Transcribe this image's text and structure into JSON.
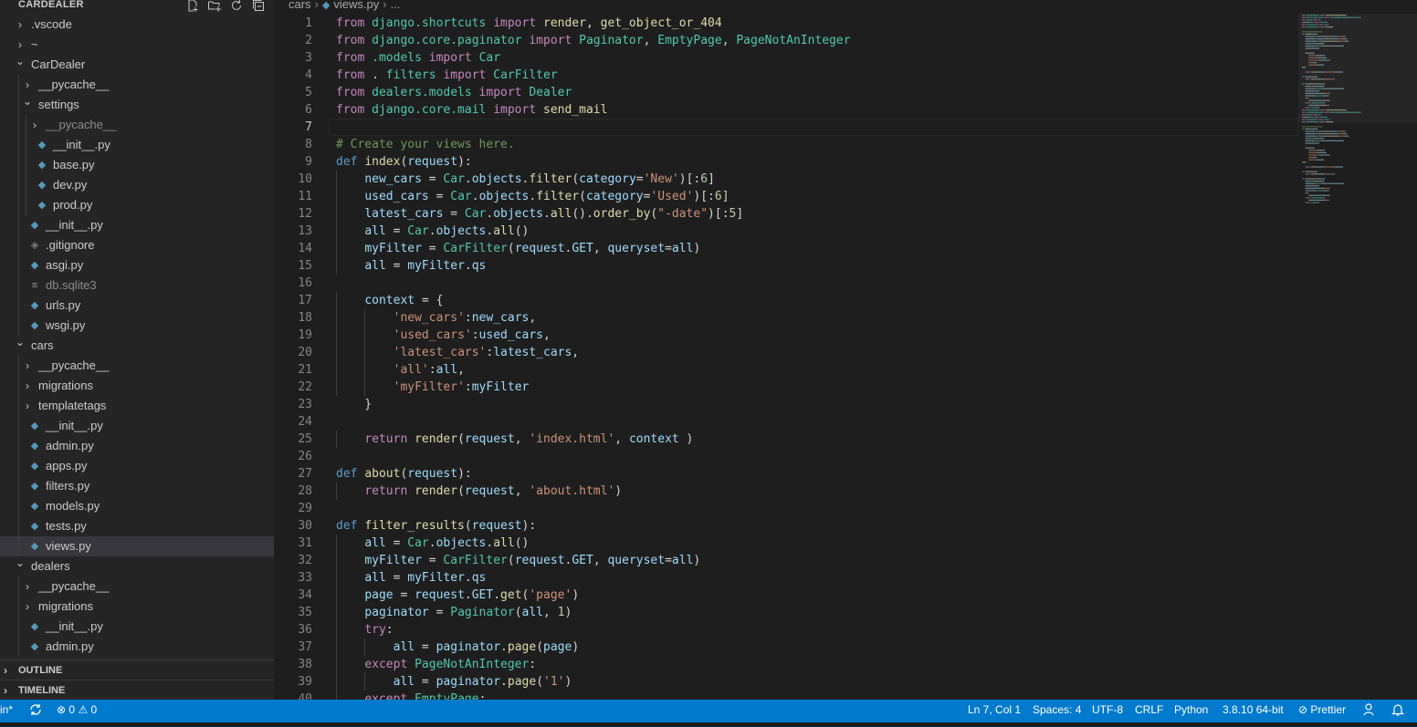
{
  "sidebar": {
    "title": "CARDEALER",
    "actions": [
      {
        "name": "new-file-icon",
        "glyph": "+"
      },
      {
        "name": "new-folder-icon",
        "glyph": "▭"
      },
      {
        "name": "refresh-icon",
        "glyph": "↻"
      },
      {
        "name": "collapse-all-icon",
        "glyph": "⊟"
      }
    ],
    "tree": [
      {
        "label": ".vscode",
        "type": "folder",
        "depth": 0,
        "open": false
      },
      {
        "label": "~",
        "type": "folder",
        "depth": 0,
        "open": false
      },
      {
        "label": "CarDealer",
        "type": "folder",
        "depth": 0,
        "open": true
      },
      {
        "label": "__pycache__",
        "type": "folder",
        "depth": 1,
        "open": false
      },
      {
        "label": "settings",
        "type": "folder",
        "depth": 1,
        "open": true
      },
      {
        "label": "__pycache__",
        "type": "folder",
        "depth": 2,
        "open": false,
        "muted": true
      },
      {
        "label": "__init__.py",
        "type": "py",
        "depth": 2
      },
      {
        "label": "base.py",
        "type": "py",
        "depth": 2
      },
      {
        "label": "dev.py",
        "type": "py",
        "depth": 2
      },
      {
        "label": "prod.py",
        "type": "py",
        "depth": 2
      },
      {
        "label": "__init__.py",
        "type": "py",
        "depth": 1
      },
      {
        "label": ".gitignore",
        "type": "git",
        "depth": 1
      },
      {
        "label": "asgi.py",
        "type": "py",
        "depth": 1
      },
      {
        "label": "db.sqlite3",
        "type": "db",
        "depth": 1,
        "muted": true
      },
      {
        "label": "urls.py",
        "type": "py",
        "depth": 1
      },
      {
        "label": "wsgi.py",
        "type": "py",
        "depth": 1
      },
      {
        "label": "cars",
        "type": "folder",
        "depth": 0,
        "open": true
      },
      {
        "label": "__pycache__",
        "type": "folder",
        "depth": 1,
        "open": false
      },
      {
        "label": "migrations",
        "type": "folder",
        "depth": 1,
        "open": false
      },
      {
        "label": "templatetags",
        "type": "folder",
        "depth": 1,
        "open": false
      },
      {
        "label": "__init__.py",
        "type": "py",
        "depth": 1
      },
      {
        "label": "admin.py",
        "type": "py",
        "depth": 1
      },
      {
        "label": "apps.py",
        "type": "py",
        "depth": 1
      },
      {
        "label": "filters.py",
        "type": "py",
        "depth": 1
      },
      {
        "label": "models.py",
        "type": "py",
        "depth": 1
      },
      {
        "label": "tests.py",
        "type": "py",
        "depth": 1
      },
      {
        "label": "views.py",
        "type": "py",
        "depth": 1,
        "active": true
      },
      {
        "label": "dealers",
        "type": "folder",
        "depth": 0,
        "open": true
      },
      {
        "label": "__pycache__",
        "type": "folder",
        "depth": 1,
        "open": false
      },
      {
        "label": "migrations",
        "type": "folder",
        "depth": 1,
        "open": false
      },
      {
        "label": "__init__.py",
        "type": "py",
        "depth": 1
      },
      {
        "label": "admin.py",
        "type": "py",
        "depth": 1
      }
    ],
    "panels": {
      "outline": "OUTLINE",
      "timeline": "TIMELINE"
    }
  },
  "breadcrumb": {
    "folder": "cars",
    "file": "views.py",
    "more": "..."
  },
  "editor": {
    "current_line": 7,
    "lines": [
      [
        [
          "kw",
          "from"
        ],
        [
          "t",
          " "
        ],
        [
          "mod",
          "django.shortcuts"
        ],
        [
          "t",
          " "
        ],
        [
          "kw",
          "import"
        ],
        [
          "t",
          " "
        ],
        [
          "fn",
          "render"
        ],
        [
          "t",
          ", "
        ],
        [
          "fn",
          "get_object_or_404"
        ]
      ],
      [
        [
          "kw",
          "from"
        ],
        [
          "t",
          " "
        ],
        [
          "mod",
          "django.core.paginator"
        ],
        [
          "t",
          " "
        ],
        [
          "kw",
          "import"
        ],
        [
          "t",
          " "
        ],
        [
          "cls",
          "Paginator"
        ],
        [
          "t",
          ", "
        ],
        [
          "cls",
          "EmptyPage"
        ],
        [
          "t",
          ", "
        ],
        [
          "cls",
          "PageNotAnInteger"
        ]
      ],
      [
        [
          "kw",
          "from"
        ],
        [
          "t",
          " "
        ],
        [
          "mod",
          ".models"
        ],
        [
          "t",
          " "
        ],
        [
          "kw",
          "import"
        ],
        [
          "t",
          " "
        ],
        [
          "cls",
          "Car"
        ]
      ],
      [
        [
          "kw",
          "from"
        ],
        [
          "t",
          " . "
        ],
        [
          "mod",
          "filters"
        ],
        [
          "t",
          " "
        ],
        [
          "kw",
          "import"
        ],
        [
          "t",
          " "
        ],
        [
          "cls",
          "CarFilter"
        ]
      ],
      [
        [
          "kw",
          "from"
        ],
        [
          "t",
          " "
        ],
        [
          "mod",
          "dealers.models"
        ],
        [
          "t",
          " "
        ],
        [
          "kw",
          "import"
        ],
        [
          "t",
          " "
        ],
        [
          "cls",
          "Dealer"
        ]
      ],
      [
        [
          "kw",
          "from"
        ],
        [
          "t",
          " "
        ],
        [
          "mod",
          "django.core.mail"
        ],
        [
          "t",
          " "
        ],
        [
          "kw",
          "import"
        ],
        [
          "t",
          " "
        ],
        [
          "fn",
          "send_mail"
        ]
      ],
      [],
      [
        [
          "cmt",
          "# Create your views here."
        ]
      ],
      [
        [
          "kwb",
          "def"
        ],
        [
          "t",
          " "
        ],
        [
          "fn",
          "index"
        ],
        [
          "t",
          "("
        ],
        [
          "var",
          "request"
        ],
        [
          "t",
          "):"
        ]
      ],
      [
        [
          "t",
          "    "
        ],
        [
          "var",
          "new_cars"
        ],
        [
          "t",
          " = "
        ],
        [
          "cls",
          "Car"
        ],
        [
          "t",
          "."
        ],
        [
          "var",
          "objects"
        ],
        [
          "t",
          "."
        ],
        [
          "fn",
          "filter"
        ],
        [
          "t",
          "("
        ],
        [
          "var",
          "category"
        ],
        [
          "t",
          "="
        ],
        [
          "str",
          "'New'"
        ],
        [
          "t",
          ")[:"
        ],
        [
          "num",
          "6"
        ],
        [
          "t",
          "]"
        ]
      ],
      [
        [
          "t",
          "    "
        ],
        [
          "var",
          "used_cars"
        ],
        [
          "t",
          " = "
        ],
        [
          "cls",
          "Car"
        ],
        [
          "t",
          "."
        ],
        [
          "var",
          "objects"
        ],
        [
          "t",
          "."
        ],
        [
          "fn",
          "filter"
        ],
        [
          "t",
          "("
        ],
        [
          "var",
          "category"
        ],
        [
          "t",
          "="
        ],
        [
          "str",
          "'Used'"
        ],
        [
          "t",
          ")[:"
        ],
        [
          "num",
          "6"
        ],
        [
          "t",
          "]"
        ]
      ],
      [
        [
          "t",
          "    "
        ],
        [
          "var",
          "latest_cars"
        ],
        [
          "t",
          " = "
        ],
        [
          "cls",
          "Car"
        ],
        [
          "t",
          "."
        ],
        [
          "var",
          "objects"
        ],
        [
          "t",
          "."
        ],
        [
          "fn",
          "all"
        ],
        [
          "t",
          "()."
        ],
        [
          "fn",
          "order_by"
        ],
        [
          "t",
          "("
        ],
        [
          "str",
          "\"-date\""
        ],
        [
          "t",
          ")[:"
        ],
        [
          "num",
          "5"
        ],
        [
          "t",
          "]"
        ]
      ],
      [
        [
          "t",
          "    "
        ],
        [
          "var",
          "all"
        ],
        [
          "t",
          " = "
        ],
        [
          "cls",
          "Car"
        ],
        [
          "t",
          "."
        ],
        [
          "var",
          "objects"
        ],
        [
          "t",
          "."
        ],
        [
          "fn",
          "all"
        ],
        [
          "t",
          "()"
        ]
      ],
      [
        [
          "t",
          "    "
        ],
        [
          "var",
          "myFilter"
        ],
        [
          "t",
          " = "
        ],
        [
          "cls",
          "CarFilter"
        ],
        [
          "t",
          "("
        ],
        [
          "var",
          "request"
        ],
        [
          "t",
          "."
        ],
        [
          "var",
          "GET"
        ],
        [
          "t",
          ", "
        ],
        [
          "var",
          "queryset"
        ],
        [
          "t",
          "="
        ],
        [
          "var",
          "all"
        ],
        [
          "t",
          ")"
        ]
      ],
      [
        [
          "t",
          "    "
        ],
        [
          "var",
          "all"
        ],
        [
          "t",
          " = "
        ],
        [
          "var",
          "myFilter"
        ],
        [
          "t",
          "."
        ],
        [
          "var",
          "qs"
        ]
      ],
      [],
      [
        [
          "t",
          "    "
        ],
        [
          "var",
          "context"
        ],
        [
          "t",
          " = {"
        ]
      ],
      [
        [
          "t",
          "        "
        ],
        [
          "str",
          "'new_cars'"
        ],
        [
          "t",
          ":"
        ],
        [
          "var",
          "new_cars"
        ],
        [
          "t",
          ","
        ]
      ],
      [
        [
          "t",
          "        "
        ],
        [
          "str",
          "'used_cars'"
        ],
        [
          "t",
          ":"
        ],
        [
          "var",
          "used_cars"
        ],
        [
          "t",
          ","
        ]
      ],
      [
        [
          "t",
          "        "
        ],
        [
          "str",
          "'latest_cars'"
        ],
        [
          "t",
          ":"
        ],
        [
          "var",
          "latest_cars"
        ],
        [
          "t",
          ","
        ]
      ],
      [
        [
          "t",
          "        "
        ],
        [
          "str",
          "'all'"
        ],
        [
          "t",
          ":"
        ],
        [
          "var",
          "all"
        ],
        [
          "t",
          ","
        ]
      ],
      [
        [
          "t",
          "        "
        ],
        [
          "str",
          "'myFilter'"
        ],
        [
          "t",
          ":"
        ],
        [
          "var",
          "myFilter"
        ]
      ],
      [
        [
          "t",
          "    }"
        ]
      ],
      [],
      [
        [
          "t",
          "    "
        ],
        [
          "kw",
          "return"
        ],
        [
          "t",
          " "
        ],
        [
          "fn",
          "render"
        ],
        [
          "t",
          "("
        ],
        [
          "var",
          "request"
        ],
        [
          "t",
          ", "
        ],
        [
          "str",
          "'index.html'"
        ],
        [
          "t",
          ", "
        ],
        [
          "var",
          "context"
        ],
        [
          "t",
          " )"
        ]
      ],
      [],
      [
        [
          "kwb",
          "def"
        ],
        [
          "t",
          " "
        ],
        [
          "fn",
          "about"
        ],
        [
          "t",
          "("
        ],
        [
          "var",
          "request"
        ],
        [
          "t",
          "):"
        ]
      ],
      [
        [
          "t",
          "    "
        ],
        [
          "kw",
          "return"
        ],
        [
          "t",
          " "
        ],
        [
          "fn",
          "render"
        ],
        [
          "t",
          "("
        ],
        [
          "var",
          "request"
        ],
        [
          "t",
          ", "
        ],
        [
          "str",
          "'about.html'"
        ],
        [
          "t",
          ")"
        ]
      ],
      [],
      [
        [
          "kwb",
          "def"
        ],
        [
          "t",
          " "
        ],
        [
          "fn",
          "filter_results"
        ],
        [
          "t",
          "("
        ],
        [
          "var",
          "request"
        ],
        [
          "t",
          "):"
        ]
      ],
      [
        [
          "t",
          "    "
        ],
        [
          "var",
          "all"
        ],
        [
          "t",
          " = "
        ],
        [
          "cls",
          "Car"
        ],
        [
          "t",
          "."
        ],
        [
          "var",
          "objects"
        ],
        [
          "t",
          "."
        ],
        [
          "fn",
          "all"
        ],
        [
          "t",
          "()"
        ]
      ],
      [
        [
          "t",
          "    "
        ],
        [
          "var",
          "myFilter"
        ],
        [
          "t",
          " = "
        ],
        [
          "cls",
          "CarFilter"
        ],
        [
          "t",
          "("
        ],
        [
          "var",
          "request"
        ],
        [
          "t",
          "."
        ],
        [
          "var",
          "GET"
        ],
        [
          "t",
          ", "
        ],
        [
          "var",
          "queryset"
        ],
        [
          "t",
          "="
        ],
        [
          "var",
          "all"
        ],
        [
          "t",
          ")"
        ]
      ],
      [
        [
          "t",
          "    "
        ],
        [
          "var",
          "all"
        ],
        [
          "t",
          " = "
        ],
        [
          "var",
          "myFilter"
        ],
        [
          "t",
          "."
        ],
        [
          "var",
          "qs"
        ]
      ],
      [
        [
          "t",
          "    "
        ],
        [
          "var",
          "page"
        ],
        [
          "t",
          " = "
        ],
        [
          "var",
          "request"
        ],
        [
          "t",
          "."
        ],
        [
          "var",
          "GET"
        ],
        [
          "t",
          "."
        ],
        [
          "fn",
          "get"
        ],
        [
          "t",
          "("
        ],
        [
          "str",
          "'page'"
        ],
        [
          "t",
          ")"
        ]
      ],
      [
        [
          "t",
          "    "
        ],
        [
          "var",
          "paginator"
        ],
        [
          "t",
          " = "
        ],
        [
          "cls",
          "Paginator"
        ],
        [
          "t",
          "("
        ],
        [
          "var",
          "all"
        ],
        [
          "t",
          ", "
        ],
        [
          "num",
          "1"
        ],
        [
          "t",
          ")"
        ]
      ],
      [
        [
          "t",
          "    "
        ],
        [
          "kw",
          "try"
        ],
        [
          "t",
          ":"
        ]
      ],
      [
        [
          "t",
          "        "
        ],
        [
          "var",
          "all"
        ],
        [
          "t",
          " = "
        ],
        [
          "var",
          "paginator"
        ],
        [
          "t",
          "."
        ],
        [
          "fn",
          "page"
        ],
        [
          "t",
          "("
        ],
        [
          "var",
          "page"
        ],
        [
          "t",
          ")"
        ]
      ],
      [
        [
          "t",
          "    "
        ],
        [
          "kw",
          "except"
        ],
        [
          "t",
          " "
        ],
        [
          "cls",
          "PageNotAnInteger"
        ],
        [
          "t",
          ":"
        ]
      ],
      [
        [
          "t",
          "        "
        ],
        [
          "var",
          "all"
        ],
        [
          "t",
          " = "
        ],
        [
          "var",
          "paginator"
        ],
        [
          "t",
          "."
        ],
        [
          "fn",
          "page"
        ],
        [
          "t",
          "("
        ],
        [
          "str",
          "'1'"
        ],
        [
          "t",
          ")"
        ]
      ],
      [
        [
          "t",
          "    "
        ],
        [
          "kw",
          "except"
        ],
        [
          "t",
          " "
        ],
        [
          "cls",
          "EmptyPage"
        ],
        [
          "t",
          ":"
        ]
      ]
    ]
  },
  "status": {
    "branch": "in*",
    "sync_icon": "sync-icon",
    "errors": "0",
    "warnings": "0",
    "position": "Ln 7, Col 1",
    "spaces": "Spaces: 4",
    "encoding": "UTF-8",
    "eol": "CRLF",
    "language": "Python",
    "interpreter": "3.8.10 64-bit",
    "prettier": "Prettier",
    "colors": {
      "bar": "#007acc"
    }
  }
}
